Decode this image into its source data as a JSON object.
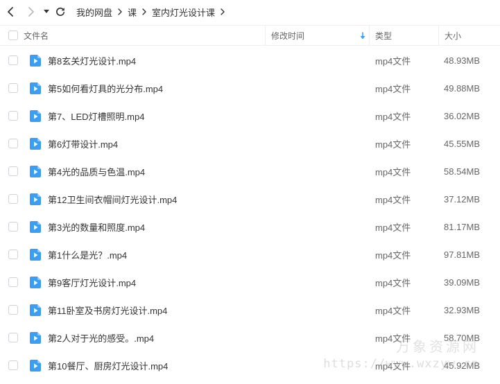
{
  "nav": {
    "back_icon": "chevron-left-icon",
    "forward_icon": "chevron-right-icon",
    "dropdown_icon": "caret-down-icon",
    "refresh_icon": "refresh-icon"
  },
  "breadcrumb": [
    "我的网盘",
    "课",
    "室内灯光设计课"
  ],
  "columns": {
    "name": "文件名",
    "modified": "修改时间",
    "type": "类型",
    "size": "大小"
  },
  "sort": {
    "column": "modified",
    "icon": "arrow-down-icon",
    "color": "#3a9ef5"
  },
  "accent": "#3a9ef5",
  "files": [
    {
      "name": "第8玄关灯光设计.mp4",
      "type": "mp4文件",
      "size": "48.93MB"
    },
    {
      "name": "第5如何看灯具的光分布.mp4",
      "type": "mp4文件",
      "size": "49.88MB"
    },
    {
      "name": "第7、LED灯槽照明.mp4",
      "type": "mp4文件",
      "size": "36.02MB"
    },
    {
      "name": "第6灯带设计.mp4",
      "type": "mp4文件",
      "size": "45.55MB"
    },
    {
      "name": "第4光的品质与色温.mp4",
      "type": "mp4文件",
      "size": "58.54MB"
    },
    {
      "name": "第12卫生间衣帽间灯光设计.mp4",
      "type": "mp4文件",
      "size": "37.12MB"
    },
    {
      "name": "第3光的数量和照度.mp4",
      "type": "mp4文件",
      "size": "81.17MB"
    },
    {
      "name": "第1什么是光？.mp4",
      "type": "mp4文件",
      "size": "97.81MB"
    },
    {
      "name": "第9客厅灯光设计.mp4",
      "type": "mp4文件",
      "size": "39.09MB"
    },
    {
      "name": "第11卧室及书房灯光设计.mp4",
      "type": "mp4文件",
      "size": "32.93MB"
    },
    {
      "name": "第2人对于光的感受。.mp4",
      "type": "mp4文件",
      "size": "58.70MB"
    },
    {
      "name": "第10餐厅、厨房灯光设计.mp4",
      "type": "mp4文件",
      "size": "45.92MB"
    }
  ],
  "watermark": {
    "cn": "万象资源网",
    "url": "https://www.wxzyw.cn"
  }
}
